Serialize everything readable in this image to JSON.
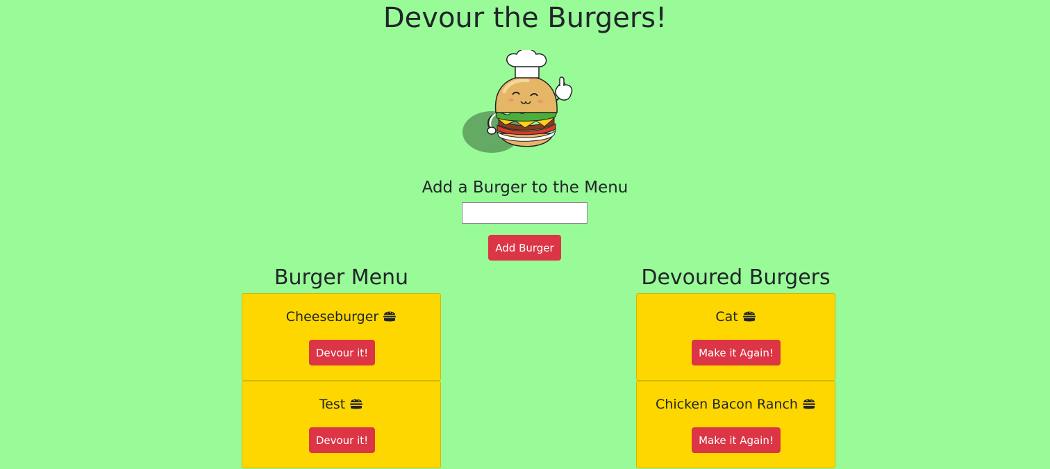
{
  "header": {
    "title": "Devour the Burgers!"
  },
  "form": {
    "title": "Add a Burger to the Menu",
    "input_value": "",
    "input_placeholder": "",
    "add_button_label": "Add Burger"
  },
  "menu": {
    "heading": "Burger Menu",
    "items": [
      {
        "name": "Cheeseburger",
        "button_label": "Devour it!"
      },
      {
        "name": "Test",
        "button_label": "Devour it!"
      }
    ]
  },
  "devoured": {
    "heading": "Devoured Burgers",
    "items": [
      {
        "name": "Cat",
        "button_label": "Make it Again!"
      },
      {
        "name": "Chicken Bacon Ranch",
        "button_label": "Make it Again!"
      }
    ]
  },
  "icons": {
    "burger_item_icon": "hamburger-icon",
    "mascot": "burger-chef-mascot"
  },
  "colors": {
    "background": "#98fb98",
    "card": "#ffd700",
    "button": "#dc3545",
    "text": "#212529"
  }
}
